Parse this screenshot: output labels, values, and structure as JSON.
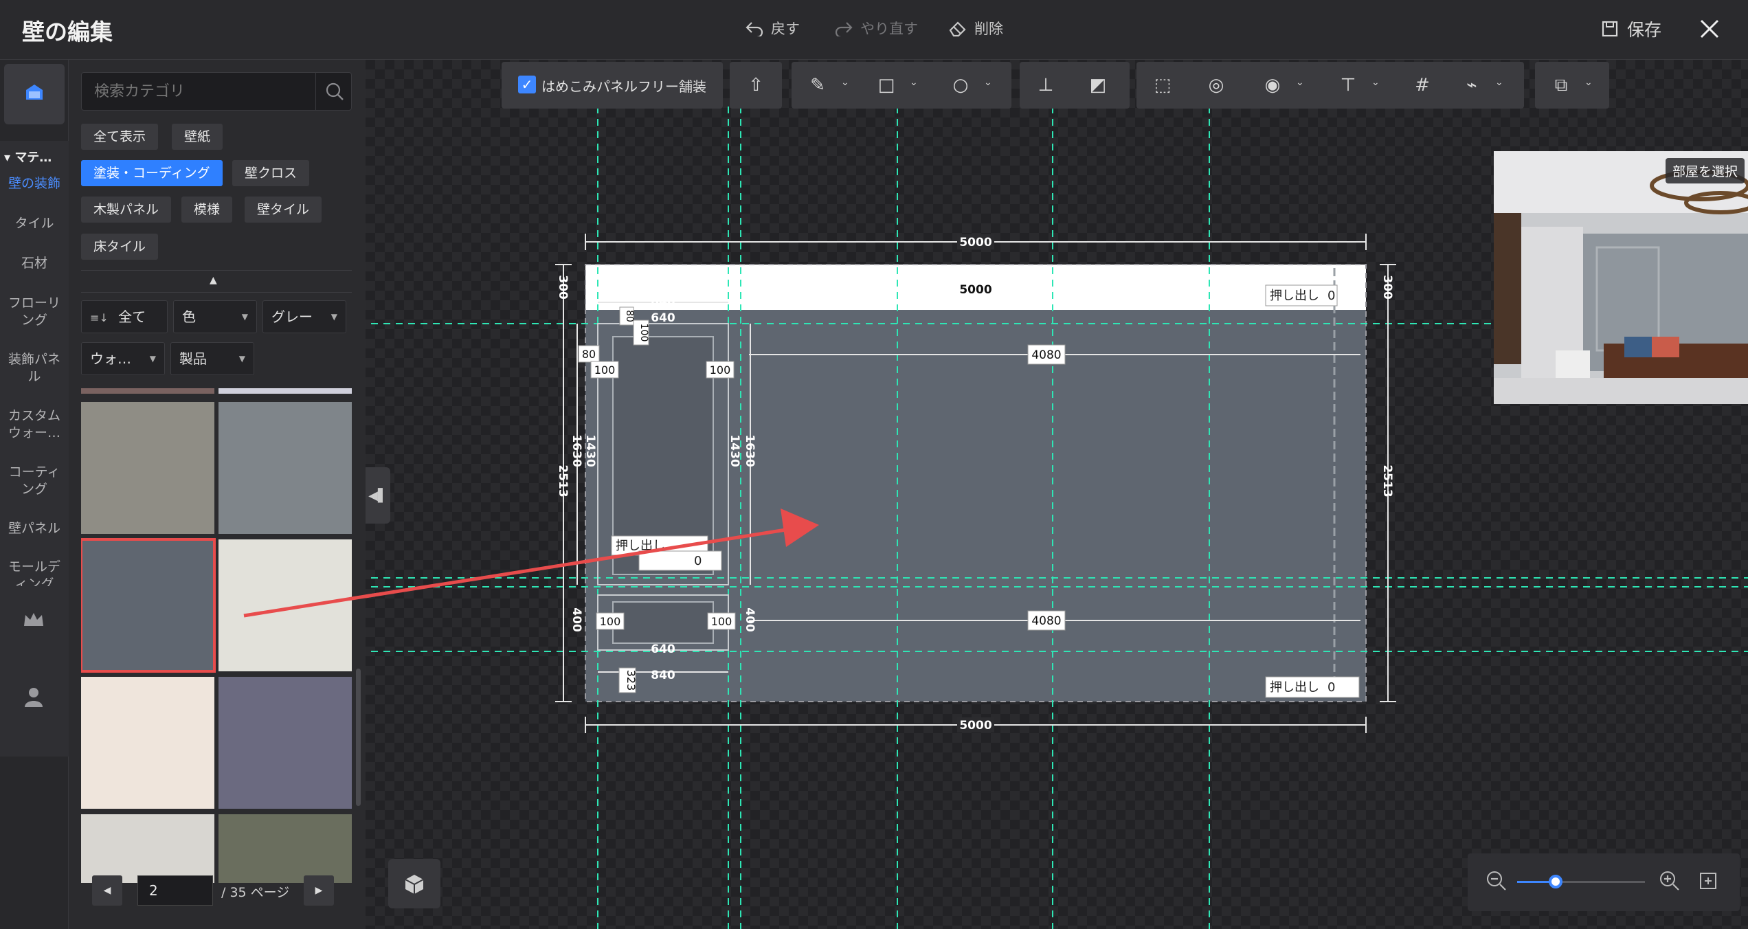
{
  "header": {
    "title": "壁の編集",
    "undo_label": "戻す",
    "redo_label": "やり直す",
    "delete_label": "削除",
    "save_label": "保存"
  },
  "rail": {
    "section_label": "マテ…",
    "items": [
      {
        "label": "壁の装飾",
        "active": true
      },
      {
        "label": "タイル"
      },
      {
        "label": "石材"
      },
      {
        "label": "フローリング"
      },
      {
        "label": "装飾パネル"
      },
      {
        "label": "カスタムウォー…"
      },
      {
        "label": "コーティング"
      },
      {
        "label": "壁パネル"
      },
      {
        "label": "モールディング"
      }
    ]
  },
  "panel": {
    "search_placeholder": "検索カテゴリ",
    "chips": [
      {
        "label": "全て表示"
      },
      {
        "label": "壁紙"
      },
      {
        "label": "塗装・コーディング",
        "active": true
      },
      {
        "label": "壁クロス"
      },
      {
        "label": "木製パネル"
      },
      {
        "label": "模様"
      },
      {
        "label": "壁タイル"
      },
      {
        "label": "床タイル"
      }
    ],
    "filters": {
      "sort": "全て",
      "color": "色",
      "gray": "グレー",
      "wall": "ウォ…",
      "product": "製品"
    },
    "swatches": [
      "#8f8d85",
      "#7f858a",
      "#5f6670",
      "#e2e1da",
      "#efe5dc",
      "#6b6a80",
      "#d8d6d1",
      "#6a6e5e"
    ],
    "top_swatch_strips": [
      "#7a6260",
      "#d0d0dc"
    ],
    "pager": {
      "current_page": "2",
      "total_label": "/ 35 ページ"
    }
  },
  "toolbar": {
    "checkbox_label": "はめこみパネルフリー舗装",
    "checkbox_checked": true
  },
  "preview": {
    "label": "部屋を選択"
  },
  "drawing": {
    "wall_width": "5000",
    "top_band": "5000",
    "height_total": "2513",
    "top_band_height": "300",
    "span_1": "4080",
    "span_2": "4080",
    "extrude_label": "押し出し",
    "extrude_value": "0",
    "door_width_outer": "840",
    "door_width_inner": "640",
    "frame": "80",
    "frame2": "100",
    "door_height_outer": "1630",
    "door_height_inner": "1430",
    "lower_height": "400",
    "bottom_offset": "323"
  },
  "zoom": {
    "level": 0.3
  },
  "colors": {
    "accent": "#2f80ff",
    "guide": "#2ee6b5",
    "wall": "#5f6670",
    "highlight": "#e84c4c"
  }
}
